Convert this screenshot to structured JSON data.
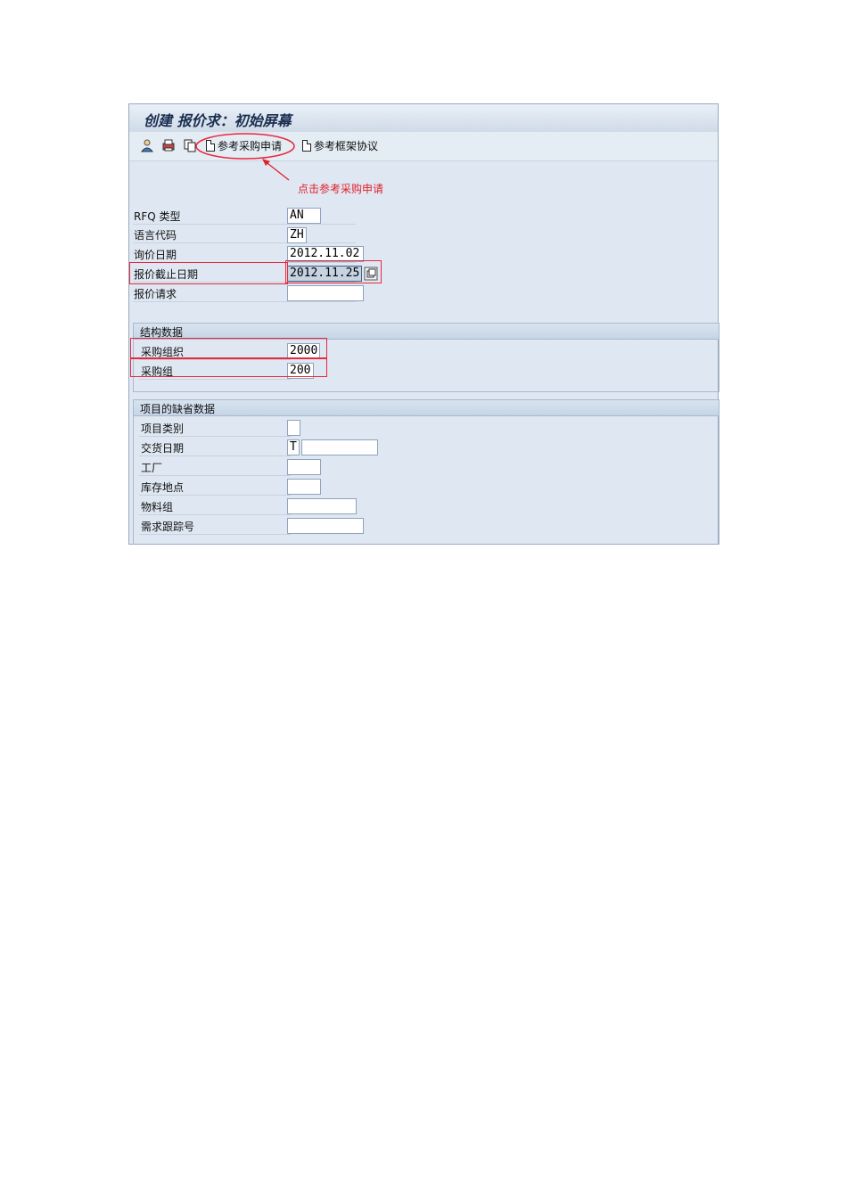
{
  "window": {
    "title": "创建 报价求：初始屏幕"
  },
  "toolbar": {
    "icons": [
      "person-icon",
      "print-icon",
      "copy-icon"
    ],
    "ref_requisition_label": "参考采购申请",
    "ref_framework_label": "参考框架协议"
  },
  "annotation": {
    "text": "点击参考采购申请",
    "color": "#e0202c"
  },
  "header_fields": {
    "rfq_type": {
      "label": "RFQ 类型",
      "value": "AN"
    },
    "language": {
      "label": "语言代码",
      "value": "ZH"
    },
    "rfq_date": {
      "label": "询价日期",
      "value": "2012.11.02"
    },
    "deadline": {
      "label": "报价截止日期",
      "value": "2012.11.25"
    },
    "quotation_request": {
      "label": "报价请求",
      "value": ""
    }
  },
  "structure": {
    "title": "结构数据",
    "purch_org": {
      "label": "采购组织",
      "value": "2000"
    },
    "purch_group": {
      "label": "采购组",
      "value": "200"
    }
  },
  "defaults": {
    "title": "项目的缺省数据",
    "item_category": {
      "label": "项目类别",
      "value": ""
    },
    "delivery_date": {
      "label": "交货日期",
      "type_value": "T",
      "value": ""
    },
    "plant": {
      "label": "工厂",
      "value": ""
    },
    "storage_location": {
      "label": "库存地点",
      "value": ""
    },
    "material_group": {
      "label": "物料组",
      "value": ""
    },
    "tracking_number": {
      "label": "需求跟踪号",
      "value": ""
    }
  },
  "colors": {
    "highlight": "#e8283c",
    "background": "#dfe8f2"
  }
}
